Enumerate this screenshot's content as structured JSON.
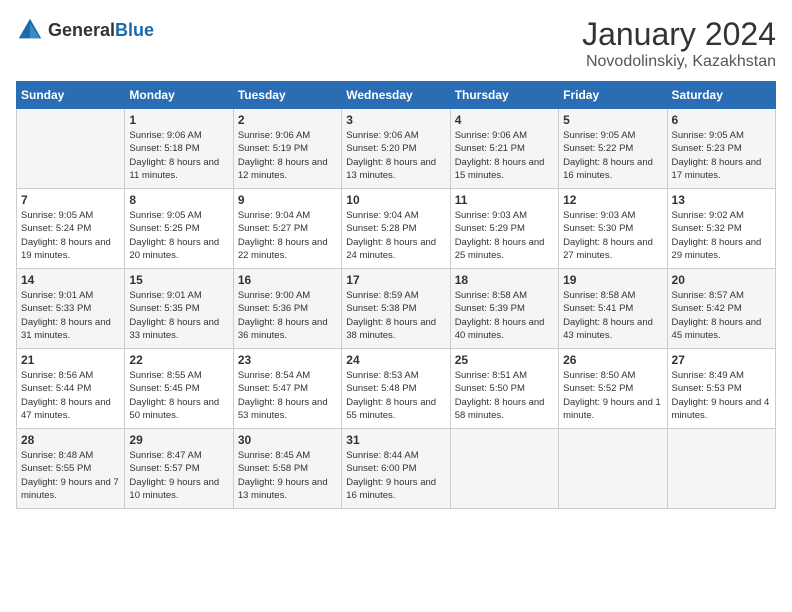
{
  "logo": {
    "general": "General",
    "blue": "Blue"
  },
  "header": {
    "month": "January 2024",
    "location": "Novodolinskiy, Kazakhstan"
  },
  "weekdays": [
    "Sunday",
    "Monday",
    "Tuesday",
    "Wednesday",
    "Thursday",
    "Friday",
    "Saturday"
  ],
  "weeks": [
    [
      {
        "day": null,
        "sunrise": null,
        "sunset": null,
        "daylight": null
      },
      {
        "day": "1",
        "sunrise": "Sunrise: 9:06 AM",
        "sunset": "Sunset: 5:18 PM",
        "daylight": "Daylight: 8 hours and 11 minutes."
      },
      {
        "day": "2",
        "sunrise": "Sunrise: 9:06 AM",
        "sunset": "Sunset: 5:19 PM",
        "daylight": "Daylight: 8 hours and 12 minutes."
      },
      {
        "day": "3",
        "sunrise": "Sunrise: 9:06 AM",
        "sunset": "Sunset: 5:20 PM",
        "daylight": "Daylight: 8 hours and 13 minutes."
      },
      {
        "day": "4",
        "sunrise": "Sunrise: 9:06 AM",
        "sunset": "Sunset: 5:21 PM",
        "daylight": "Daylight: 8 hours and 15 minutes."
      },
      {
        "day": "5",
        "sunrise": "Sunrise: 9:05 AM",
        "sunset": "Sunset: 5:22 PM",
        "daylight": "Daylight: 8 hours and 16 minutes."
      },
      {
        "day": "6",
        "sunrise": "Sunrise: 9:05 AM",
        "sunset": "Sunset: 5:23 PM",
        "daylight": "Daylight: 8 hours and 17 minutes."
      }
    ],
    [
      {
        "day": "7",
        "sunrise": "Sunrise: 9:05 AM",
        "sunset": "Sunset: 5:24 PM",
        "daylight": "Daylight: 8 hours and 19 minutes."
      },
      {
        "day": "8",
        "sunrise": "Sunrise: 9:05 AM",
        "sunset": "Sunset: 5:25 PM",
        "daylight": "Daylight: 8 hours and 20 minutes."
      },
      {
        "day": "9",
        "sunrise": "Sunrise: 9:04 AM",
        "sunset": "Sunset: 5:27 PM",
        "daylight": "Daylight: 8 hours and 22 minutes."
      },
      {
        "day": "10",
        "sunrise": "Sunrise: 9:04 AM",
        "sunset": "Sunset: 5:28 PM",
        "daylight": "Daylight: 8 hours and 24 minutes."
      },
      {
        "day": "11",
        "sunrise": "Sunrise: 9:03 AM",
        "sunset": "Sunset: 5:29 PM",
        "daylight": "Daylight: 8 hours and 25 minutes."
      },
      {
        "day": "12",
        "sunrise": "Sunrise: 9:03 AM",
        "sunset": "Sunset: 5:30 PM",
        "daylight": "Daylight: 8 hours and 27 minutes."
      },
      {
        "day": "13",
        "sunrise": "Sunrise: 9:02 AM",
        "sunset": "Sunset: 5:32 PM",
        "daylight": "Daylight: 8 hours and 29 minutes."
      }
    ],
    [
      {
        "day": "14",
        "sunrise": "Sunrise: 9:01 AM",
        "sunset": "Sunset: 5:33 PM",
        "daylight": "Daylight: 8 hours and 31 minutes."
      },
      {
        "day": "15",
        "sunrise": "Sunrise: 9:01 AM",
        "sunset": "Sunset: 5:35 PM",
        "daylight": "Daylight: 8 hours and 33 minutes."
      },
      {
        "day": "16",
        "sunrise": "Sunrise: 9:00 AM",
        "sunset": "Sunset: 5:36 PM",
        "daylight": "Daylight: 8 hours and 36 minutes."
      },
      {
        "day": "17",
        "sunrise": "Sunrise: 8:59 AM",
        "sunset": "Sunset: 5:38 PM",
        "daylight": "Daylight: 8 hours and 38 minutes."
      },
      {
        "day": "18",
        "sunrise": "Sunrise: 8:58 AM",
        "sunset": "Sunset: 5:39 PM",
        "daylight": "Daylight: 8 hours and 40 minutes."
      },
      {
        "day": "19",
        "sunrise": "Sunrise: 8:58 AM",
        "sunset": "Sunset: 5:41 PM",
        "daylight": "Daylight: 8 hours and 43 minutes."
      },
      {
        "day": "20",
        "sunrise": "Sunrise: 8:57 AM",
        "sunset": "Sunset: 5:42 PM",
        "daylight": "Daylight: 8 hours and 45 minutes."
      }
    ],
    [
      {
        "day": "21",
        "sunrise": "Sunrise: 8:56 AM",
        "sunset": "Sunset: 5:44 PM",
        "daylight": "Daylight: 8 hours and 47 minutes."
      },
      {
        "day": "22",
        "sunrise": "Sunrise: 8:55 AM",
        "sunset": "Sunset: 5:45 PM",
        "daylight": "Daylight: 8 hours and 50 minutes."
      },
      {
        "day": "23",
        "sunrise": "Sunrise: 8:54 AM",
        "sunset": "Sunset: 5:47 PM",
        "daylight": "Daylight: 8 hours and 53 minutes."
      },
      {
        "day": "24",
        "sunrise": "Sunrise: 8:53 AM",
        "sunset": "Sunset: 5:48 PM",
        "daylight": "Daylight: 8 hours and 55 minutes."
      },
      {
        "day": "25",
        "sunrise": "Sunrise: 8:51 AM",
        "sunset": "Sunset: 5:50 PM",
        "daylight": "Daylight: 8 hours and 58 minutes."
      },
      {
        "day": "26",
        "sunrise": "Sunrise: 8:50 AM",
        "sunset": "Sunset: 5:52 PM",
        "daylight": "Daylight: 9 hours and 1 minute."
      },
      {
        "day": "27",
        "sunrise": "Sunrise: 8:49 AM",
        "sunset": "Sunset: 5:53 PM",
        "daylight": "Daylight: 9 hours and 4 minutes."
      }
    ],
    [
      {
        "day": "28",
        "sunrise": "Sunrise: 8:48 AM",
        "sunset": "Sunset: 5:55 PM",
        "daylight": "Daylight: 9 hours and 7 minutes."
      },
      {
        "day": "29",
        "sunrise": "Sunrise: 8:47 AM",
        "sunset": "Sunset: 5:57 PM",
        "daylight": "Daylight: 9 hours and 10 minutes."
      },
      {
        "day": "30",
        "sunrise": "Sunrise: 8:45 AM",
        "sunset": "Sunset: 5:58 PM",
        "daylight": "Daylight: 9 hours and 13 minutes."
      },
      {
        "day": "31",
        "sunrise": "Sunrise: 8:44 AM",
        "sunset": "Sunset: 6:00 PM",
        "daylight": "Daylight: 9 hours and 16 minutes."
      },
      {
        "day": null,
        "sunrise": null,
        "sunset": null,
        "daylight": null
      },
      {
        "day": null,
        "sunrise": null,
        "sunset": null,
        "daylight": null
      },
      {
        "day": null,
        "sunrise": null,
        "sunset": null,
        "daylight": null
      }
    ]
  ]
}
